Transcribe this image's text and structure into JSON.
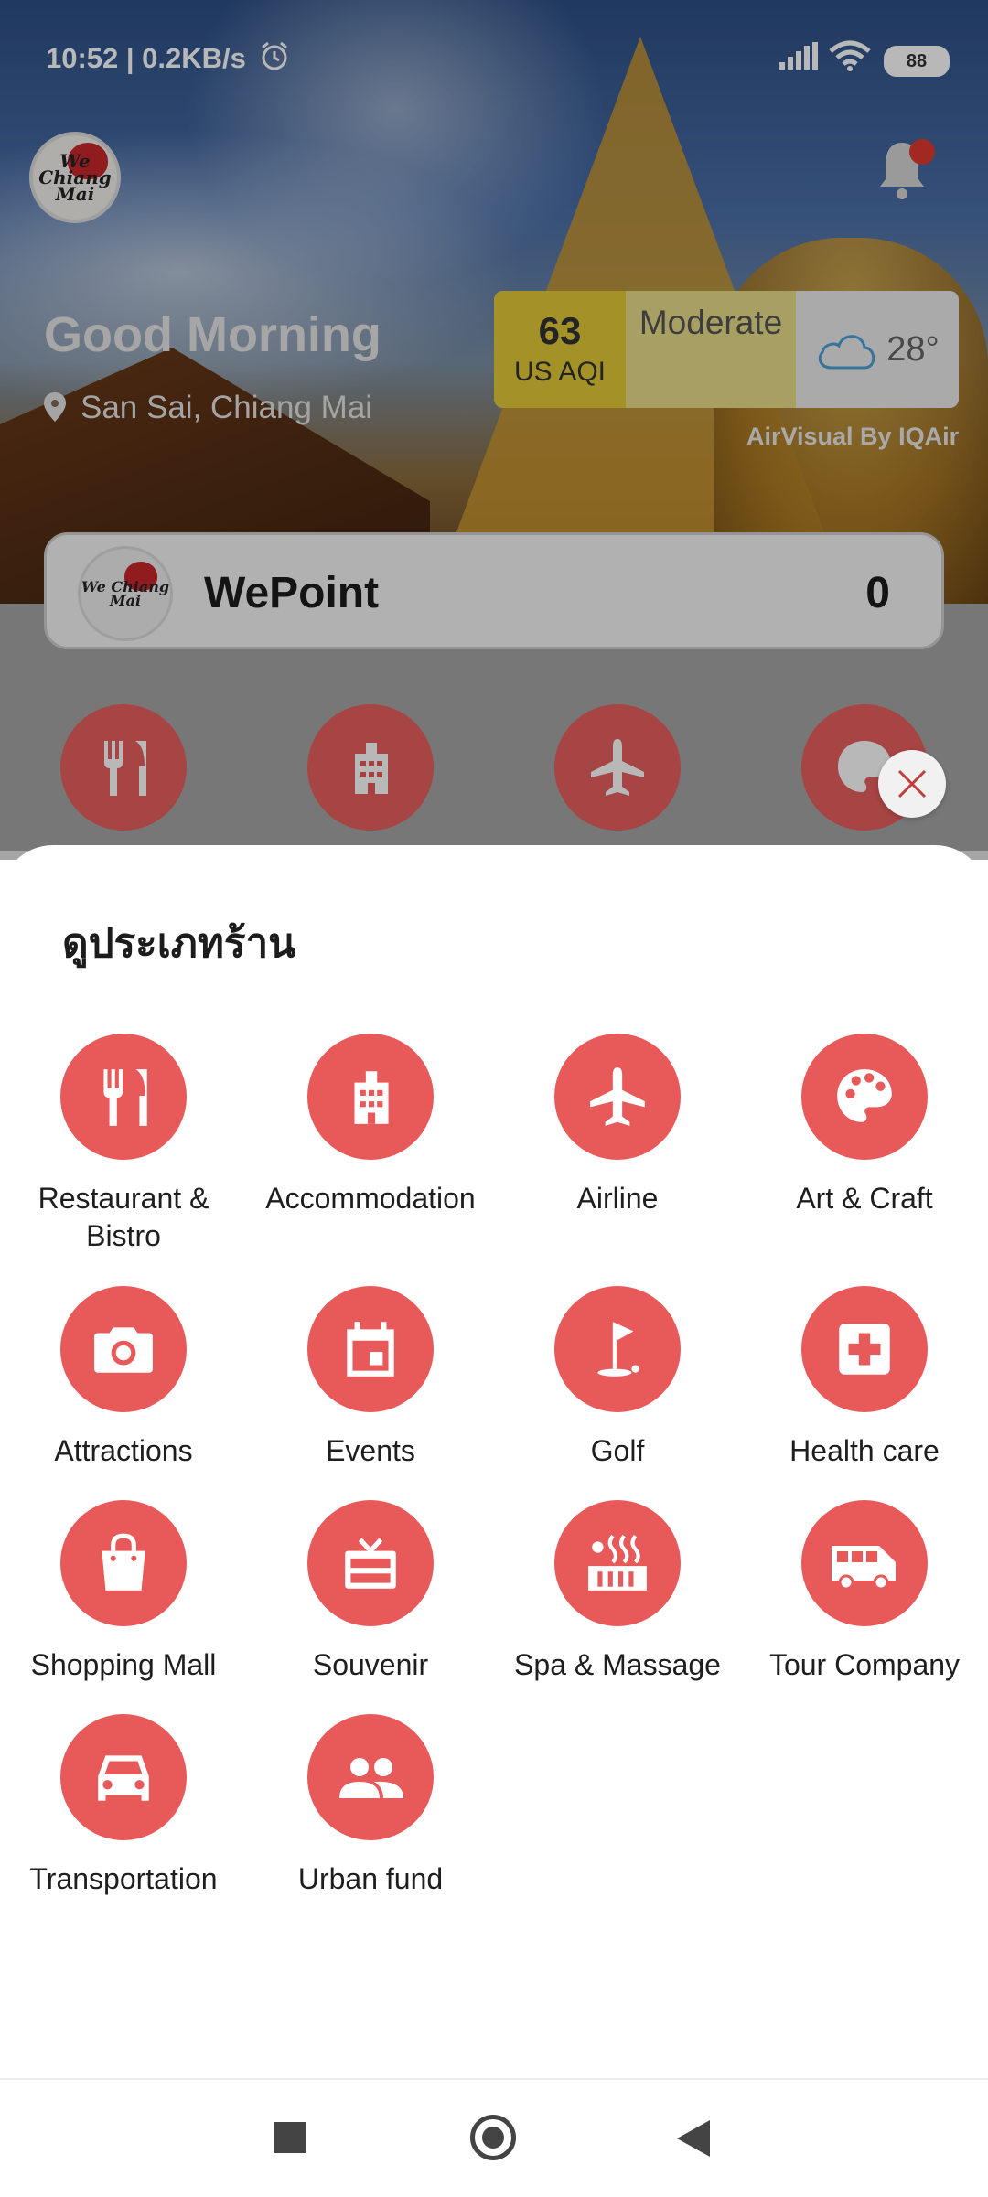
{
  "status_bar": {
    "time_speed": "10:52 | 0.2KB/s",
    "battery": "88"
  },
  "header": {
    "greeting": "Good Morning",
    "location": "San Sai, Chiang Mai",
    "logo_text": "We Chiang Mai"
  },
  "air_quality": {
    "aqi_value": "63",
    "aqi_unit": "US AQI",
    "level": "Moderate",
    "temperature": "28°",
    "provider": "AirVisual By IQAir"
  },
  "wepoint": {
    "title": "WePoint",
    "points": "0"
  },
  "sheet": {
    "title": "ดูประเภทร้าน",
    "categories": [
      {
        "label": "Restaurant & Bistro",
        "icon": "utensils-icon"
      },
      {
        "label": "Accommodation",
        "icon": "building-icon"
      },
      {
        "label": "Airline",
        "icon": "airplane-icon"
      },
      {
        "label": "Art & Craft",
        "icon": "palette-icon"
      },
      {
        "label": "Attractions",
        "icon": "camera-icon"
      },
      {
        "label": "Events",
        "icon": "calendar-icon"
      },
      {
        "label": "Golf",
        "icon": "golf-flag-icon"
      },
      {
        "label": "Health care",
        "icon": "medical-cross-icon"
      },
      {
        "label": "Shopping Mall",
        "icon": "shopping-bag-icon"
      },
      {
        "label": "Souvenir",
        "icon": "gift-icon"
      },
      {
        "label": "Spa & Massage",
        "icon": "hot-spring-icon"
      },
      {
        "label": "Tour Company",
        "icon": "van-icon"
      },
      {
        "label": "Transportation",
        "icon": "car-icon"
      },
      {
        "label": "Urban fund",
        "icon": "people-icon"
      }
    ]
  },
  "colors": {
    "accent": "#e85a5a",
    "aqi_moderate": "#e3cb3a"
  }
}
